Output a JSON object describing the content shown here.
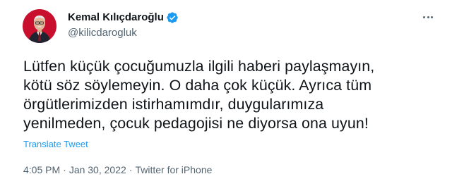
{
  "author": {
    "display_name": "Kemal Kılıçdaroğlu",
    "handle": "@kilicdarogluk",
    "verified": true
  },
  "tweet": {
    "lines": [
      "Lütfen küçük çocuğumuzla ilgili haberi paylaşmayın,",
      "kötü söz söylemeyin. O daha çok küçük. Ayrıca tüm",
      "örgütlerimizden istirhamımdır, duygularımıza",
      "yenilmeden, çocuk pedagojisi ne diyorsa ona uyun!"
    ],
    "translate_label": "Translate Tweet"
  },
  "meta": {
    "time": "4:05 PM",
    "separator": "·",
    "date": "Jan 30, 2022",
    "source": "Twitter for iPhone"
  },
  "icons": {
    "more": "more-options-icon",
    "verified": "verified-badge-icon"
  },
  "colors": {
    "accent": "#1d9bf0",
    "secondary_text": "#536471",
    "primary_text": "#0f1419",
    "avatar_background": "#c8102e"
  }
}
